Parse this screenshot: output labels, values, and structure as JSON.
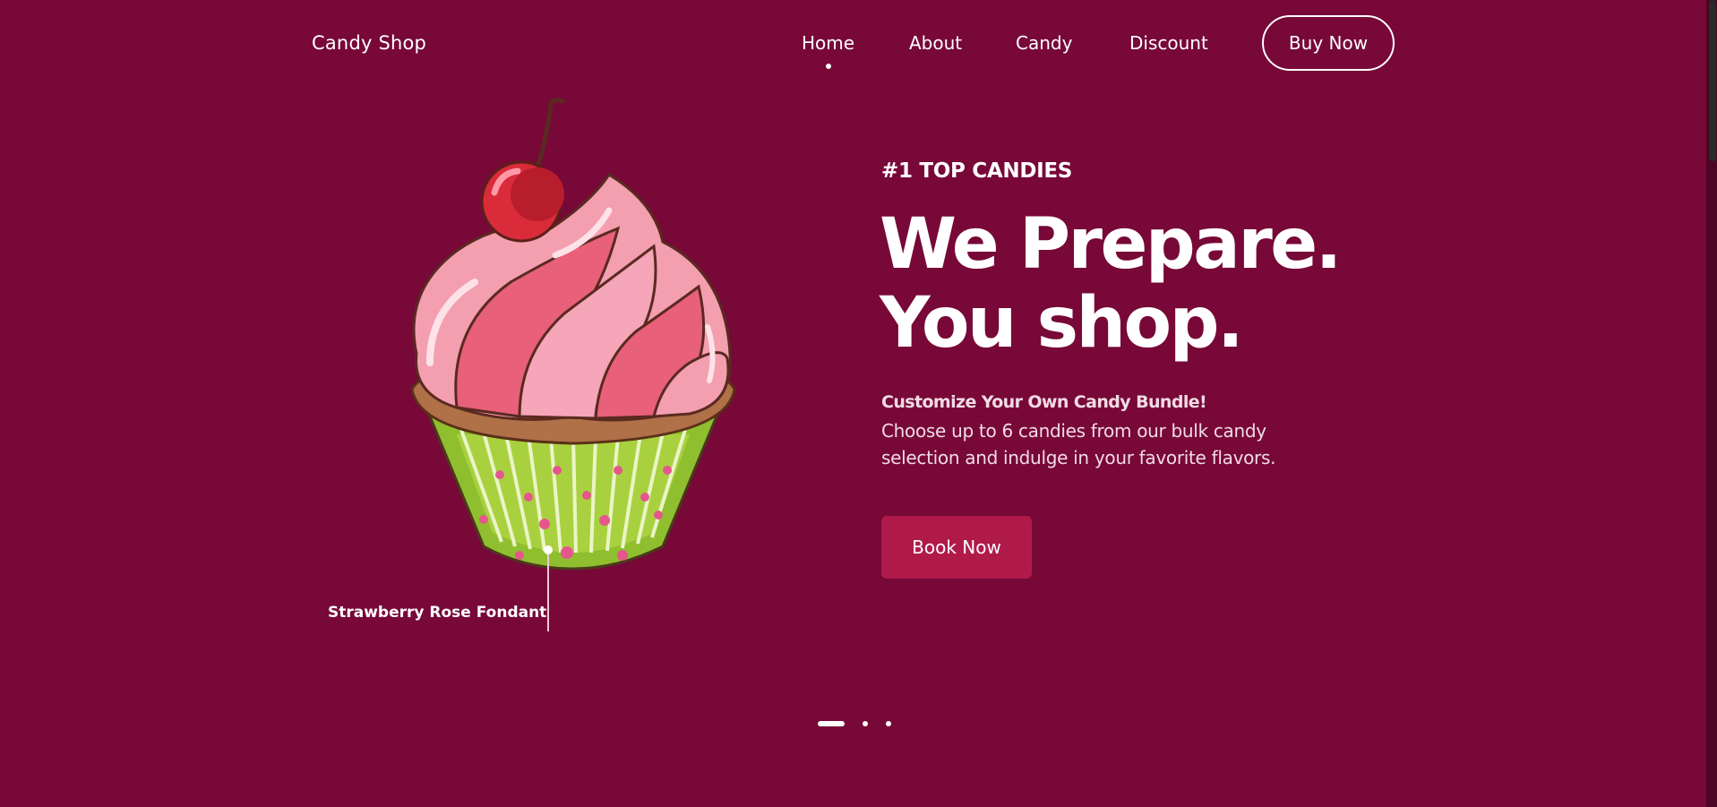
{
  "header": {
    "brand": "Candy Shop",
    "nav": [
      {
        "label": "Home",
        "active": true
      },
      {
        "label": "About"
      },
      {
        "label": "Candy"
      },
      {
        "label": "Discount"
      }
    ],
    "cta_label": "Buy Now"
  },
  "hero": {
    "eyebrow": "#1 TOP CANDIES",
    "headline_line1": "We Prepare.",
    "headline_line2": "You shop.",
    "subhead": "Customize Your Own Candy Bundle!",
    "description": "Choose up to 6 candies from our bulk candy selection and indulge in your favorite flavors.",
    "book_label": "Book Now",
    "illustration": "cupcake-illustration",
    "flavor_label": "Strawberry Rose Fondant"
  },
  "carousel": {
    "total_slides": 3,
    "active_index": 0
  },
  "colors": {
    "background": "#770838",
    "button": "#b01a4a",
    "text": "#ffffff"
  }
}
